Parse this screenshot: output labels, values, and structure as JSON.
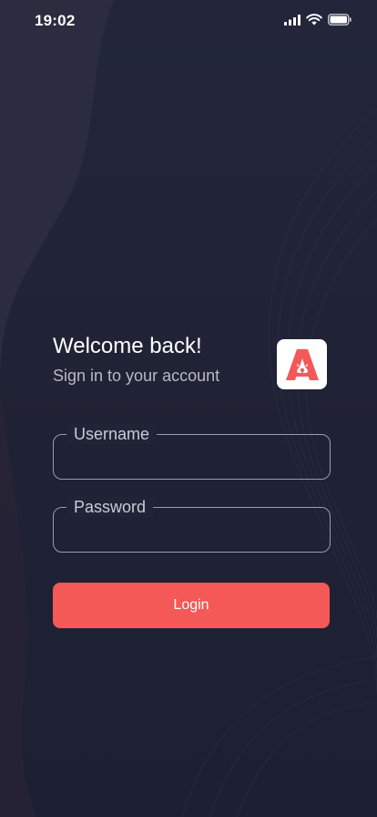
{
  "status_bar": {
    "time": "19:02",
    "icons": [
      "cellular-signal-icon",
      "wifi-icon",
      "battery-icon"
    ]
  },
  "header": {
    "title": "Welcome back!",
    "subtitle": "Sign in to your account",
    "logo_icon": "app-logo-icon"
  },
  "form": {
    "username": {
      "label": "Username",
      "value": ""
    },
    "password": {
      "label": "Password",
      "value": ""
    },
    "login_label": "Login"
  },
  "colors": {
    "background": "#1f2233",
    "accent": "#f45857",
    "text_primary": "#ffffff",
    "text_secondary": "#b7b9c7",
    "field_border": "#9a9cad"
  }
}
